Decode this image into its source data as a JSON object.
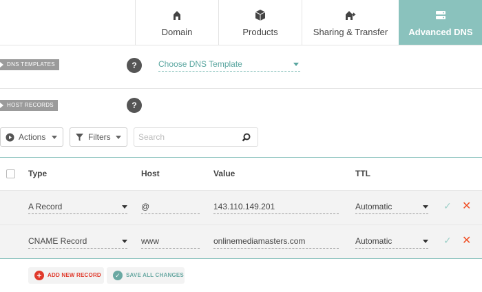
{
  "tabs": [
    {
      "label": "Domain",
      "icon": "home-icon",
      "active": false
    },
    {
      "label": "Products",
      "icon": "box-icon",
      "active": false
    },
    {
      "label": "Sharing & Transfer",
      "icon": "transfer-icon",
      "active": false
    },
    {
      "label": "Advanced DNS",
      "icon": "server-icon",
      "active": true
    }
  ],
  "dns_templates": {
    "label": "DNS TEMPLATES",
    "help": "?",
    "select_value": "Choose DNS Template"
  },
  "host_records": {
    "label": "HOST RECORDS",
    "help": "?"
  },
  "toolbar": {
    "actions_label": "Actions",
    "filters_label": "Filters",
    "search_placeholder": "Search"
  },
  "table": {
    "headers": {
      "type": "Type",
      "host": "Host",
      "value": "Value",
      "ttl": "TTL"
    },
    "rows": [
      {
        "type": "A Record",
        "host": "@",
        "value": "143.110.149.201",
        "ttl": "Automatic"
      },
      {
        "type": "CNAME Record",
        "host": "www",
        "value": "onlinemediamasters.com",
        "ttl": "Automatic"
      }
    ]
  },
  "footer": {
    "add_label": "ADD NEW RECORD",
    "save_label": "SAVE ALL CHANGES"
  },
  "colors": {
    "accent": "#8ac2bd",
    "delete": "#f04e23",
    "add": "#e0392b",
    "save": "#6aa9a3"
  }
}
